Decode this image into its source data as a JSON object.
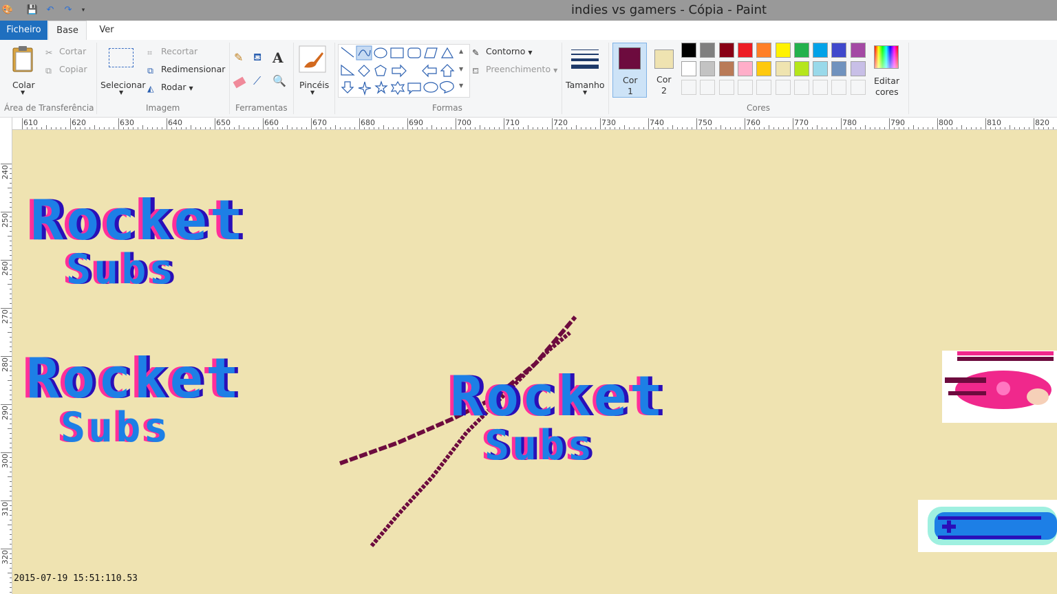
{
  "window": {
    "title": "indies vs gamers - Cópia - Paint"
  },
  "tabs": {
    "file": "Ficheiro",
    "home": "Base",
    "view": "Ver"
  },
  "clipboard": {
    "paste": "Colar",
    "cut": "Cortar",
    "copy": "Copiar",
    "label": "Área de Transferência"
  },
  "image": {
    "select": "Selecionar",
    "crop": "Recortar",
    "resize": "Redimensionar",
    "rotate": "Rodar",
    "label": "Imagem"
  },
  "tools": {
    "label": "Ferramentas"
  },
  "brushes": {
    "label": "Pincéis"
  },
  "shapes": {
    "outline": "Contorno",
    "fill": "Preenchimento",
    "label": "Formas"
  },
  "size": {
    "label": "Tamanho"
  },
  "colors": {
    "color1_label": "Cor",
    "color1_num": "1",
    "color2_label": "Cor",
    "color2_num": "2",
    "edit_label": "Editar",
    "edit_label2": "cores",
    "label": "Cores",
    "color1": "#6d0b3e",
    "color2": "#efe3b1",
    "palette_row1": [
      "#000000",
      "#7f7f7f",
      "#880015",
      "#ed1c24",
      "#ff7f27",
      "#fff200",
      "#22b14c",
      "#00a2e8",
      "#3f48cc",
      "#a349a4"
    ],
    "palette_row2": [
      "#ffffff",
      "#c3c3c3",
      "#b97a57",
      "#ffaec9",
      "#ffc90e",
      "#efe4b0",
      "#b5e61d",
      "#99d9ea",
      "#7092be",
      "#c8bfe7"
    ]
  },
  "ruler": {
    "top_ticks": [
      "610",
      "620",
      "630",
      "640",
      "650",
      "660",
      "670",
      "680",
      "690",
      "700",
      "710",
      "720",
      "730",
      "740",
      "750",
      "760",
      "770",
      "780",
      "790",
      "800",
      "810",
      "820"
    ],
    "left_ticks": [
      "240",
      "250",
      "260",
      "270",
      "280",
      "290",
      "300",
      "310",
      "320"
    ]
  },
  "canvas": {
    "logo1_line1": "Rocket",
    "logo1_line2": "Subs",
    "logo2_line1": "Rocket",
    "logo2_line2": "Subs",
    "logo3_line1": "Rocket",
    "logo3_line2": "Subs",
    "background": "#efe3b1",
    "accent_blue": "#1d7fe6",
    "accent_dark": "#2a0fb8",
    "accent_pink": "#ff2f9a",
    "line_color": "#6d0b3e"
  },
  "status": {
    "timestamp": "2015-07-19 15:51:110.53"
  }
}
